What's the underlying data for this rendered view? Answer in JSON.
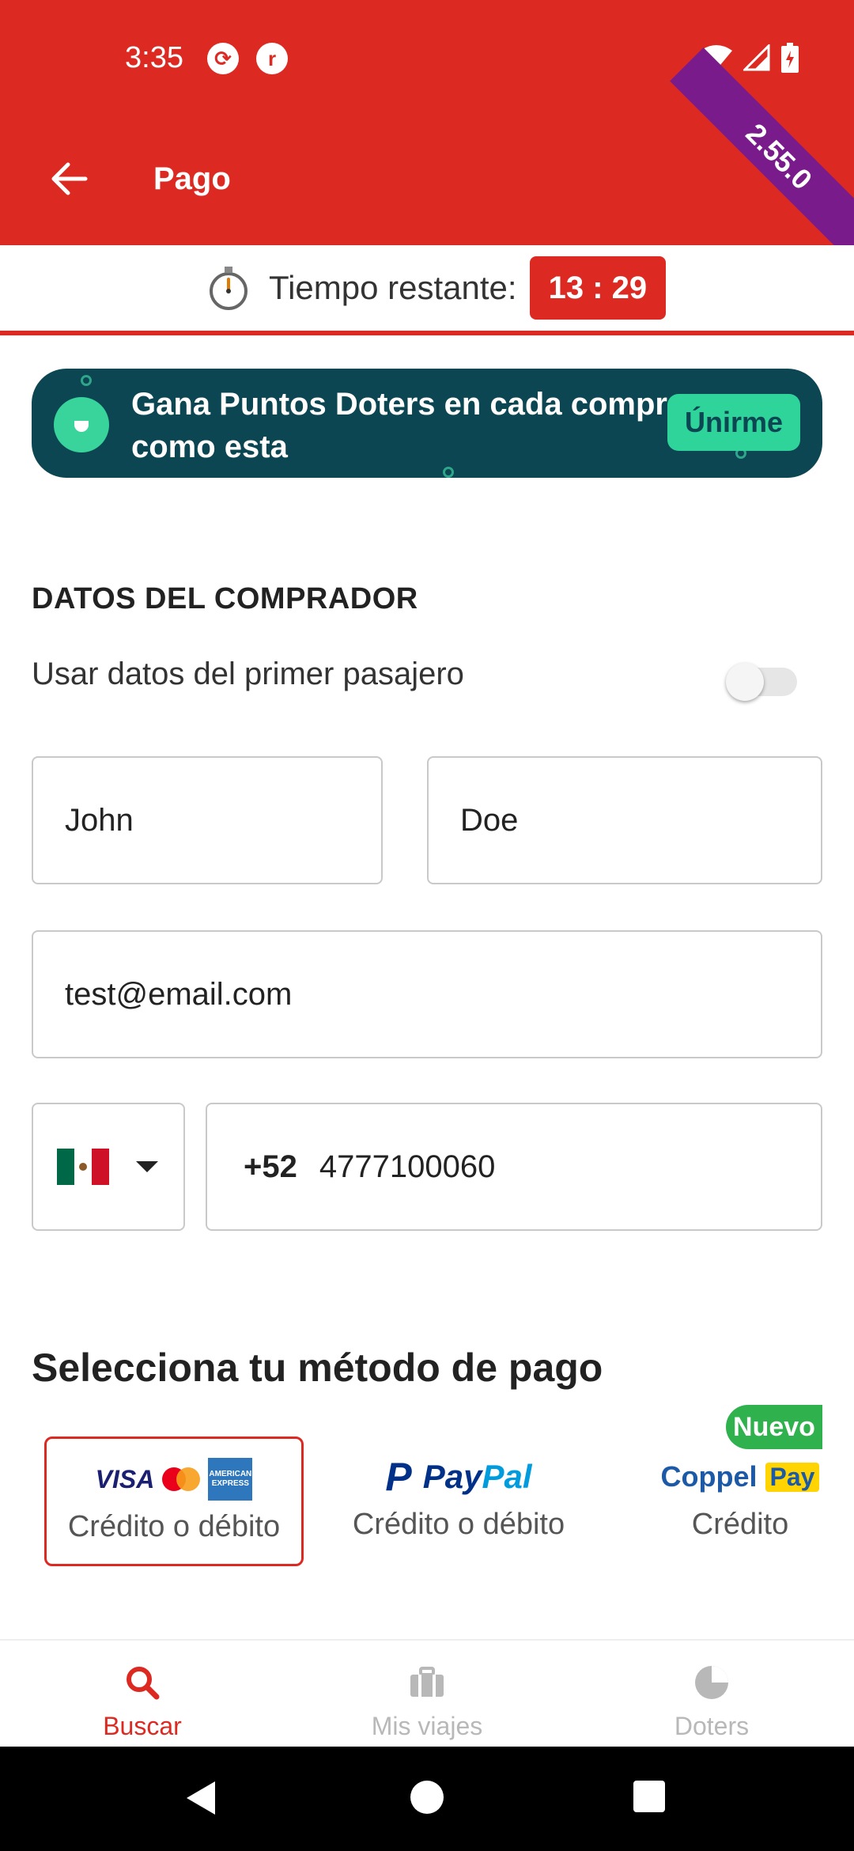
{
  "colors": {
    "brand_red": "#dc2a23",
    "banner_teal": "#0b4652",
    "banner_green": "#2fd49a",
    "ribbon_purple": "#7a1b8c",
    "new_badge_green": "#2fb14d"
  },
  "status_bar": {
    "time": "3:35",
    "icons": [
      "sync-icon",
      "app-icon",
      "wifi-icon",
      "signal-icon",
      "battery-charging-icon"
    ]
  },
  "app_bar": {
    "title": "Pago",
    "version": "2.55.0"
  },
  "timer": {
    "label": "Tiempo restante:",
    "value": "13 : 29"
  },
  "doters_banner": {
    "text": "Gana Puntos Doters en cada compra como esta",
    "button": "Únirme"
  },
  "buyer": {
    "section_title": "DATOS DEL COMPRADOR",
    "toggle_label": "Usar datos del primer pasajero",
    "toggle_on": false,
    "first_name": "John",
    "last_name": "Doe",
    "email": "test@email.com",
    "country_flag": "mexico-flag-icon",
    "phone_code": "+52",
    "phone": "4777100060"
  },
  "payment": {
    "title": "Selecciona tu método de pago",
    "methods": [
      {
        "brand": "VISA",
        "amex_text": "AMERICAN EXPRESS",
        "label": "Crédito o débito",
        "selected": true
      },
      {
        "brand_part1": "Pay",
        "brand_part2": "Pal",
        "label": "Crédito o débito",
        "selected": false
      },
      {
        "brand": "Coppel",
        "brand_badge": "Pay",
        "label": "Crédito",
        "badge": "Nuevo",
        "selected": false
      }
    ]
  },
  "bottom_nav": {
    "items": [
      {
        "label": "Buscar",
        "icon": "search-icon",
        "active": true
      },
      {
        "label": "Mis viajes",
        "icon": "briefcase-icon",
        "active": false
      },
      {
        "label": "Doters",
        "icon": "doters-icon",
        "active": false
      }
    ]
  }
}
